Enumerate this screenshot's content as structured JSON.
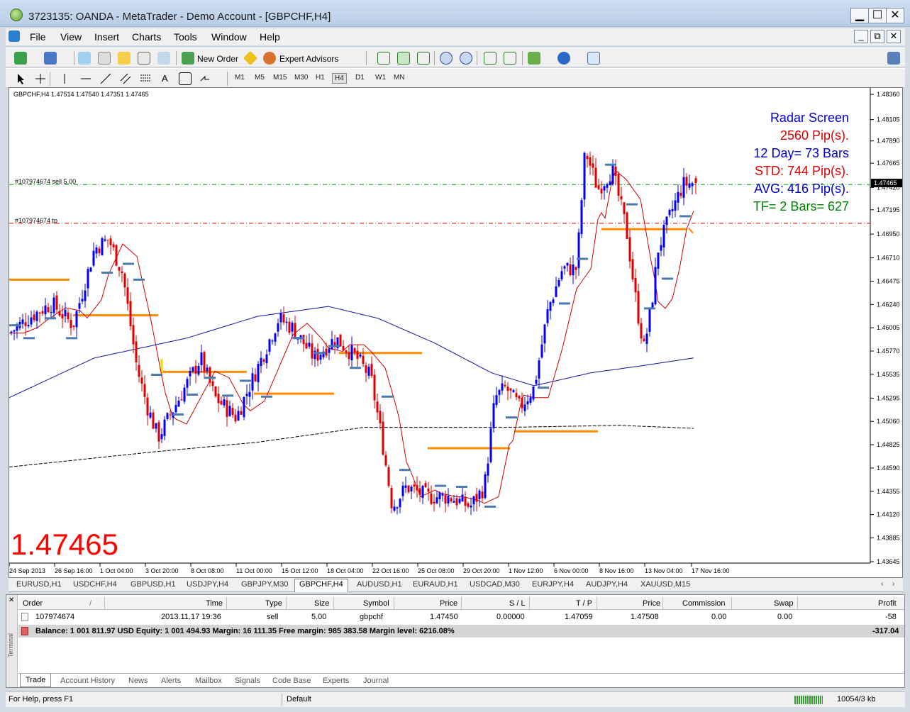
{
  "window": {
    "title": "3723135: OANDA - MetaTrader - Demo Account - [GBPCHF,H4]",
    "minimize": "▁",
    "maximize": "☐",
    "close": "✕",
    "mdi_minimize": "_",
    "mdi_restore": "⧉",
    "mdi_close": "✕"
  },
  "menu": [
    "File",
    "View",
    "Insert",
    "Charts",
    "Tools",
    "Window",
    "Help"
  ],
  "toolbar": {
    "new_order": "New Order",
    "expert_advisors": "Expert Advisors",
    "timeframes": [
      "M1",
      "M5",
      "M15",
      "M30",
      "H1",
      "H4",
      "D1",
      "W1",
      "MN"
    ],
    "active_timeframe": "H4",
    "draw_text_tool": "A"
  },
  "chart": {
    "symbol_info": "GBPCHF,H4  1.47514 1.47540 1.47351 1.47465",
    "big_price": "1.47465",
    "current_price": "1.47465",
    "sell_order_label": "#107974674 sell 5.00",
    "tp_label": "#107974674 tp",
    "radar": [
      {
        "text": "Radar Screen",
        "color": "#0000cc"
      },
      {
        "text": "2560 Pip(s).",
        "color": "#e00000"
      },
      {
        "text": "12 Day= 73 Bars",
        "color": "#0000cc"
      },
      {
        "text": "STD: 744 Pip(s).",
        "color": "#e00000"
      },
      {
        "text": "AVG: 416 Pip(s).",
        "color": "#0000cc"
      },
      {
        "text": "TF= 2 Bars= 627",
        "color": "#008000"
      }
    ],
    "colors": {
      "bull": "#0000ff",
      "bear": "#e00000",
      "level": "#ff8c00",
      "ma_fast": "#d00000",
      "ma_slow": "#1010a0",
      "ma_long": "#000000",
      "grid_bid": "#00a000",
      "tp_line": "#e00000"
    }
  },
  "chart_data": {
    "type": "candlestick",
    "price_axis": [
      "1.48360",
      "1.48105",
      "1.47890",
      "1.47665",
      "1.47420",
      "1.47195",
      "1.46950",
      "1.46710",
      "1.46475",
      "1.46240",
      "1.46005",
      "1.45770",
      "1.45535",
      "1.45295",
      "1.45060",
      "1.44825",
      "1.44590",
      "1.44355",
      "1.44120",
      "1.43885",
      "1.43645"
    ],
    "time_axis": [
      "24 Sep 2013",
      "26 Sep 16:00",
      "1 Oct 04:00",
      "3 Oct 20:00",
      "8 Oct 08:00",
      "11 Oct 00:00",
      "15 Oct 12:00",
      "18 Oct 04:00",
      "22 Oct 16:00",
      "25 Oct 08:00",
      "29 Oct 20:00",
      "1 Nov 12:00",
      "6 Nov 00:00",
      "8 Nov 16:00",
      "13 Nov 04:00",
      "17 Nov 16:00"
    ],
    "ylim": [
      1.43645,
      1.4836
    ],
    "sell_price": 1.4745,
    "take_profit": 1.47059,
    "last": {
      "open": 1.47514,
      "high": 1.4754,
      "low": 1.47351,
      "close": 1.47465
    }
  },
  "symbol_tabs": [
    "EURUSD,H1",
    "USDCHF,H4",
    "GBPUSD,H1",
    "USDJPY,H4",
    "GBPJPY,M30",
    "GBPCHF,H4",
    "AUDUSD,H1",
    "EURAUD,H1",
    "USDCAD,M30",
    "EURJPY,H4",
    "AUDJPY,H4",
    "XAUUSD,M15"
  ],
  "active_symbol_tab": "GBPCHF,H4",
  "terminal": {
    "side_label": "Terminal",
    "columns": [
      "Order",
      "/",
      "Time",
      "Type",
      "Size",
      "Symbol",
      "Price",
      "S / L",
      "T / P",
      "Price",
      "Commission",
      "Swap",
      "Profit"
    ],
    "order": {
      "order": "107974674",
      "time": "2013.11.17 19:36",
      "type": "sell",
      "size": "5.00",
      "symbol": "gbpchf",
      "price": "1.47450",
      "sl": "0.00000",
      "tp": "1.47059",
      "cur_price": "1.47508",
      "commission": "0.00",
      "swap": "0.00",
      "profit": "-58"
    },
    "balance_text": "Balance: 1 001 811.97 USD  Equity: 1 001 494.93  Margin: 16 111.35  Free margin: 985 383.58  Margin level: 6216.08%",
    "balance_profit": "-317.04",
    "tabs": [
      "Trade",
      "Account History",
      "News",
      "Alerts",
      "Mailbox",
      "Signals",
      "Code Base",
      "Experts",
      "Journal"
    ],
    "active_tab": "Trade"
  },
  "status": {
    "help": "For Help, press F1",
    "profile": "Default",
    "traffic": "10054/3 kb"
  }
}
